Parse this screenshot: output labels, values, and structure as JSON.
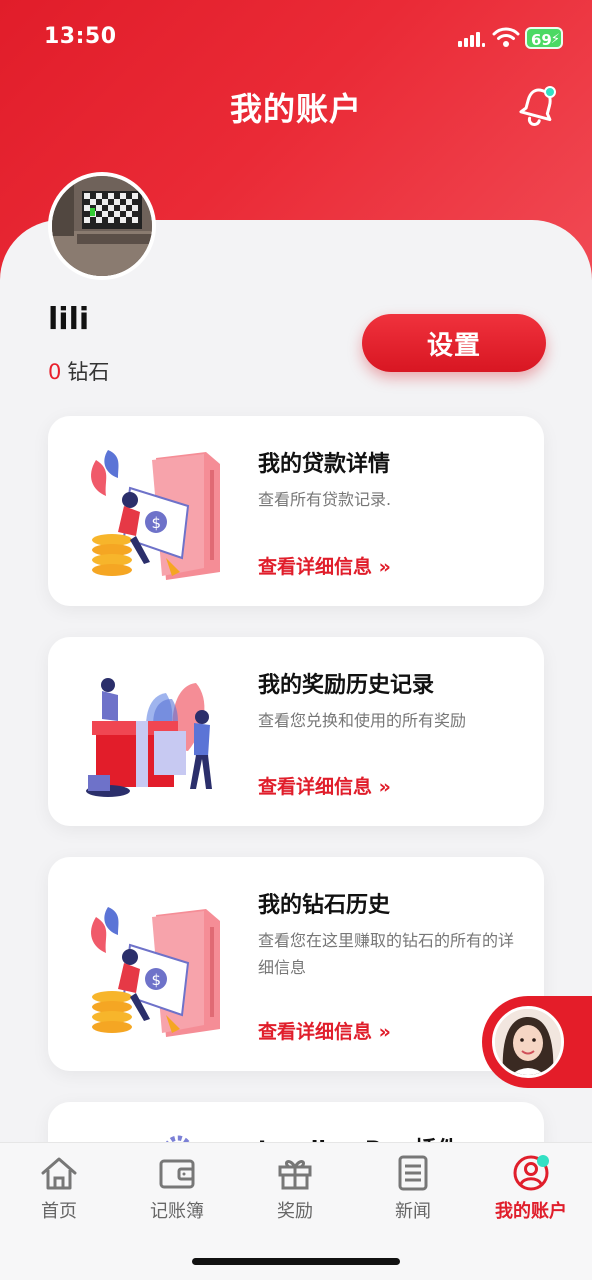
{
  "status_bar": {
    "time": "13:50",
    "battery": "69"
  },
  "header": {
    "title": "我的账户"
  },
  "profile": {
    "username": "lili",
    "diamond_count": "0",
    "diamond_label": "钻石",
    "settings_label": "设置"
  },
  "cards": [
    {
      "title": "我的贷款详情",
      "description": "查看所有贷款记录.",
      "link": "查看详细信息 »"
    },
    {
      "title": "我的奖励历史记录",
      "description": "查看您兑换和使用的所有奖励",
      "link": "查看详细信息 »"
    },
    {
      "title": "我的钻石历史",
      "description": "查看您在这里赚取的钻石的所有的详细信息",
      "link": "查看详细信息 »"
    },
    {
      "title": "Lending Pro 插件"
    }
  ],
  "bottom_nav": [
    {
      "label": "首页",
      "icon": "home-icon"
    },
    {
      "label": "记账簿",
      "icon": "wallet-icon"
    },
    {
      "label": "奖励",
      "icon": "gift-icon"
    },
    {
      "label": "新闻",
      "icon": "news-icon"
    },
    {
      "label": "我的账户",
      "icon": "account-icon",
      "active": true
    }
  ],
  "colors": {
    "accent": "#e01e2b",
    "notification_dot": "#33e0c3",
    "battery": "#4cd964"
  }
}
